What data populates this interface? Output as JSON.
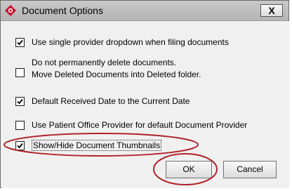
{
  "window": {
    "title": "Document Options",
    "close_label": "X"
  },
  "options": [
    {
      "line1": "Use single provider dropdown when filing documents",
      "line2": "",
      "checked": true
    },
    {
      "line1": "Do not permanently delete documents.",
      "line2": "Move Deleted Documents into Deleted folder.",
      "checked": false
    },
    {
      "line1": "Default Received Date to the Current Date",
      "line2": "",
      "checked": true
    },
    {
      "line1": "Use Patient Office Provider for default Document Provider",
      "line2": "",
      "checked": false
    },
    {
      "line1": "Show/Hide Document Thumbnails",
      "line2": "",
      "checked": true
    }
  ],
  "buttons": {
    "ok": "OK",
    "cancel": "Cancel"
  },
  "colors": {
    "annotation_circle": "#b0232b",
    "app_icon": "#c8102e"
  }
}
